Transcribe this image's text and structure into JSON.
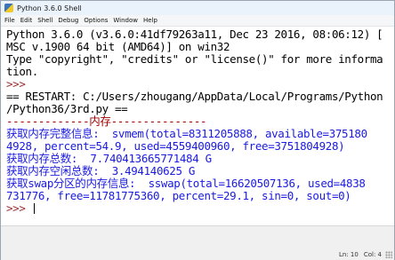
{
  "window": {
    "title": "Python 3.6.0 Shell"
  },
  "menu": [
    "File",
    "Edit",
    "Shell",
    "Debug",
    "Options",
    "Window",
    "Help"
  ],
  "shell": {
    "lines": [
      {
        "text": "Python 3.6.0 (v3.6.0:41df79263a11, Dec 23 2016, 08:06:12) [",
        "style": "black"
      },
      {
        "text": "MSC v.1900 64 bit (AMD64)] on win32",
        "style": "black"
      },
      {
        "text": "Type \"copyright\", \"credits\" or \"license()\" for more informa",
        "style": "black"
      },
      {
        "text": "tion.",
        "style": "black"
      },
      {
        "text": ">>> ",
        "style": "prompt"
      },
      {
        "text": "== RESTART: C:/Users/zhougang/AppData/Local/Programs/Python",
        "style": "black"
      },
      {
        "text": "/Python36/3rd.py ==",
        "style": "black"
      },
      {
        "text": "-------------内存---------------",
        "style": "red"
      },
      {
        "text": "获取内存完整信息:  svmem(total=8311205888, available=375180",
        "style": "blue"
      },
      {
        "text": "4928, percent=54.9, used=4559400960, free=3751804928)",
        "style": "blue"
      },
      {
        "text": "获取内存总数:  7.740413665771484 G",
        "style": "blue"
      },
      {
        "text": "获取内存空闲总数:  3.494140625 G",
        "style": "blue"
      },
      {
        "text": "获取swap分区的内存信息:  sswap(total=16620507136, used=4838",
        "style": "blue"
      },
      {
        "text": "731776, free=11781775360, percent=29.1, sin=0, sout=0)",
        "style": "blue"
      },
      {
        "text": ">>> ",
        "style": "prompt"
      }
    ]
  },
  "status": {
    "line": "Ln: 10",
    "col": "Col: 4"
  }
}
